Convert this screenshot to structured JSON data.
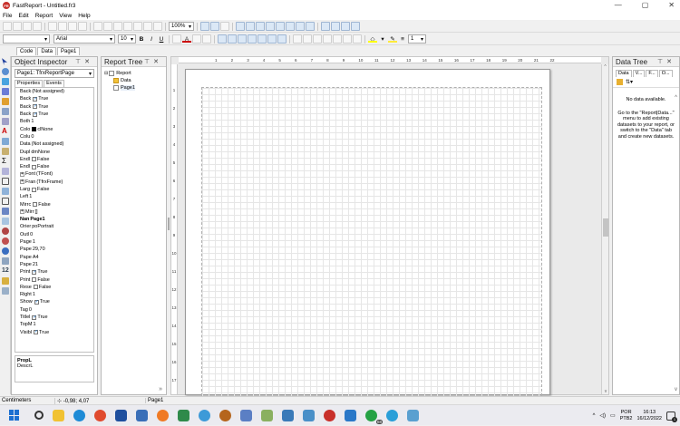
{
  "app": {
    "title": "FastReport - Untitled.fr3",
    "icon_text": "FR",
    "win_minimize": "—",
    "win_maximize": "▢",
    "win_close": "✕"
  },
  "menu": [
    "File",
    "Edit",
    "Report",
    "View",
    "Help"
  ],
  "toolbar": {
    "zoom": "100%",
    "font_name": "Arial",
    "font_size": "10",
    "bold": "B",
    "italic": "I",
    "underline": "U",
    "frame_width": "1",
    "text_color": "#cc0000",
    "fill_color": "#ffff00",
    "highlight_color": "#ffeb3b"
  },
  "page_tabs": [
    "Code",
    "Data",
    "Page1"
  ],
  "object_inspector": {
    "title": "Object Inspector",
    "selected": "Page1: TfrxReportPage",
    "tabs": [
      "Properties",
      "Events"
    ],
    "rows": [
      {
        "name": "Back",
        "value": "(Not assigned)",
        "cb": null
      },
      {
        "name": "Back",
        "value": "True",
        "cb": true
      },
      {
        "name": "Back",
        "value": "True",
        "cb": true
      },
      {
        "name": "Back",
        "value": "True",
        "cb": true
      },
      {
        "name": "Both",
        "value": "1",
        "cb": null
      },
      {
        "name": "Colo",
        "value": "clNone",
        "cb": null,
        "color": true
      },
      {
        "name": "Colu",
        "value": "0",
        "cb": null
      },
      {
        "name": "Data",
        "value": "(Not assigned)",
        "cb": null
      },
      {
        "name": "Dupl",
        "value": "dmNone",
        "cb": null
      },
      {
        "name": "Endl",
        "value": "False",
        "cb": false
      },
      {
        "name": "Endl",
        "value": "False",
        "cb": false
      },
      {
        "name": "Font",
        "value": "(TFont)",
        "cb": null,
        "exp": true
      },
      {
        "name": "Fran",
        "value": "(TfrxFrame)",
        "cb": null,
        "exp": true
      },
      {
        "name": "Larg",
        "value": "False",
        "cb": false
      },
      {
        "name": "Left",
        "value": "1",
        "cb": null
      },
      {
        "name": "Mirrc",
        "value": "False",
        "cb": false
      },
      {
        "name": "Mirr",
        "value": "[]",
        "cb": null,
        "exp": true
      },
      {
        "name": "Nan",
        "value": "Page1",
        "cb": null,
        "bold": true
      },
      {
        "name": "Orier",
        "value": "poPortrait",
        "cb": null
      },
      {
        "name": "Outl",
        "value": "0",
        "cb": null
      },
      {
        "name": "Page",
        "value": "1",
        "cb": null
      },
      {
        "name": "Pape",
        "value": "29,70",
        "cb": null
      },
      {
        "name": "Pape",
        "value": "A4",
        "cb": null
      },
      {
        "name": "Pape",
        "value": "21",
        "cb": null
      },
      {
        "name": "Print",
        "value": "True",
        "cb": true
      },
      {
        "name": "Print",
        "value": "False",
        "cb": false
      },
      {
        "name": "Rese",
        "value": "False",
        "cb": false
      },
      {
        "name": "Right",
        "value": "1",
        "cb": null
      },
      {
        "name": "Show",
        "value": "True",
        "cb": true
      },
      {
        "name": "Tag",
        "value": "0",
        "cb": null
      },
      {
        "name": "Titlel",
        "value": "True",
        "cb": true
      },
      {
        "name": "TopM",
        "value": "1",
        "cb": null
      },
      {
        "name": "Visibl",
        "value": "True",
        "cb": true
      }
    ],
    "desc_title": "PropL",
    "desc_text": "DescrL"
  },
  "report_tree": {
    "title": "Report Tree",
    "items": [
      "Report",
      "Data",
      "Page1"
    ]
  },
  "data_tree": {
    "title": "Data Tree",
    "tabs": [
      "Data",
      "V...",
      "F...",
      "O..."
    ],
    "no_data": "No data available.",
    "help": "Go to the \"Report|Data...\" menu to add existing datasets to your report, or switch to the \"Data\" tab and create new datasets."
  },
  "ruler": {
    "top": [
      "1",
      "2",
      "3",
      "4",
      "5",
      "6",
      "7",
      "8",
      "9",
      "10",
      "11",
      "12",
      "13",
      "14",
      "15",
      "16",
      "17",
      "18",
      "19",
      "20",
      "21",
      "22"
    ],
    "left": [
      "1",
      "2",
      "3",
      "4",
      "5",
      "6",
      "7",
      "8",
      "9",
      "10",
      "11",
      "12",
      "13",
      "14",
      "15",
      "16",
      "17"
    ]
  },
  "status": {
    "units": "Centimeters",
    "coords": "-0,98; 4,07",
    "page": "Page1"
  },
  "taskbar": {
    "lang": "POR",
    "lang2": "PTB2",
    "time": "16:13",
    "date": "16/12/2022",
    "badge": "68",
    "chevron": "^"
  }
}
